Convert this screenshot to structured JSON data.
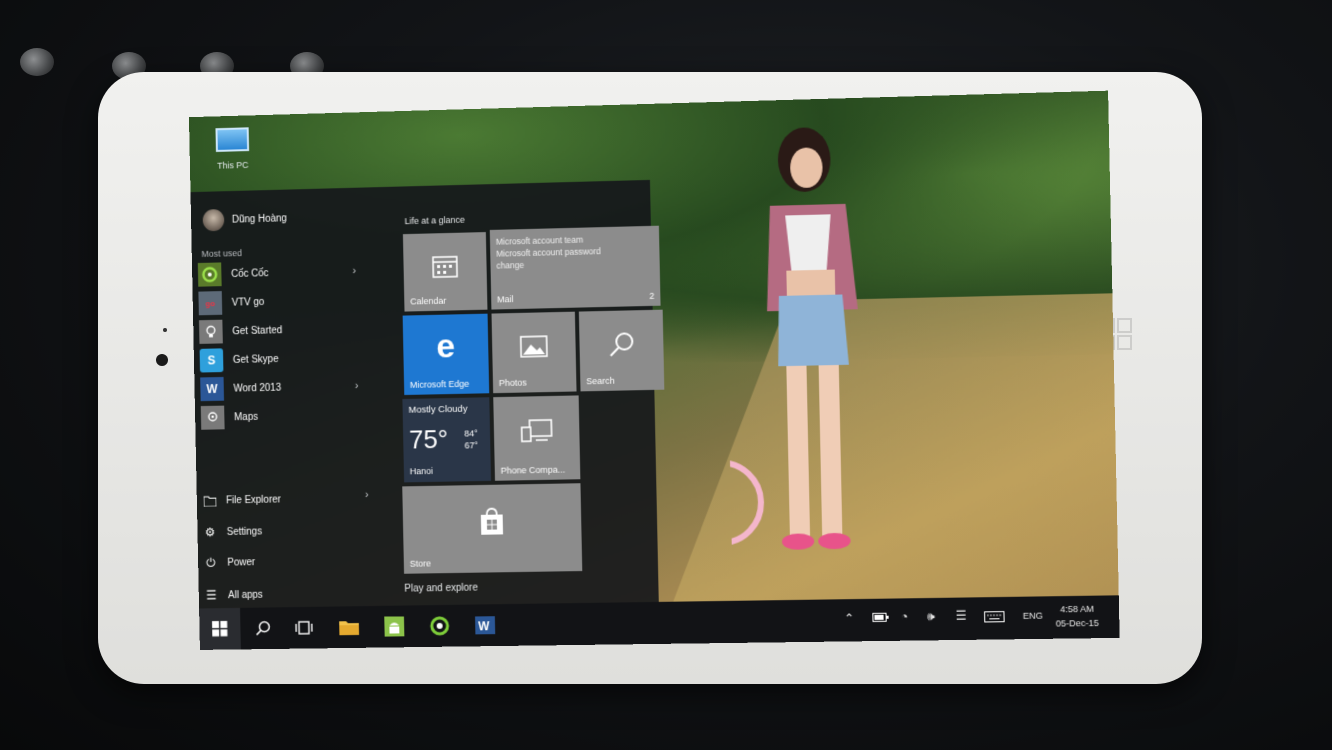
{
  "desktop": {
    "this_pc_label": "This PC"
  },
  "start_menu": {
    "user_name": "Dũng Hoàng",
    "most_used_title": "Most used",
    "most_used": [
      {
        "label": "Cốc Cốc",
        "icon": "coccoc-icon",
        "has_submenu": true
      },
      {
        "label": "VTV go",
        "icon": "vtvgo-icon",
        "has_submenu": false
      },
      {
        "label": "Get Started",
        "icon": "lightbulb-icon",
        "has_submenu": false
      },
      {
        "label": "Get Skype",
        "icon": "skype-icon",
        "has_submenu": false
      },
      {
        "label": "Word 2013",
        "icon": "word-icon",
        "has_submenu": true
      },
      {
        "label": "Maps",
        "icon": "maps-icon",
        "has_submenu": false
      }
    ],
    "file_explorer": "File Explorer",
    "settings": "Settings",
    "power": "Power",
    "all_apps": "All apps",
    "groups": {
      "life_at_a_glance": "Life at a glance",
      "play_and_explore": "Play and explore"
    },
    "tiles": {
      "calendar": "Calendar",
      "mail": {
        "label": "Mail",
        "count": "2",
        "sender": "Microsoft account team",
        "subject_line1": "Microsoft account password",
        "subject_line2": "change"
      },
      "edge": "Microsoft Edge",
      "photos": "Photos",
      "search": "Search",
      "weather": {
        "condition": "Mostly Cloudy",
        "temp": "75°",
        "high": "84°",
        "low": "67°",
        "city": "Hanoi"
      },
      "phone_companion": "Phone Compa...",
      "store": "Store"
    }
  },
  "taskbar": {
    "language": "ENG",
    "time": "4:58 AM",
    "date": "05-Dec-15"
  },
  "colors": {
    "edge_tile": "#1e78d2",
    "tile_gray": "#8c8c8c",
    "weather_tile": "#2a3648"
  }
}
